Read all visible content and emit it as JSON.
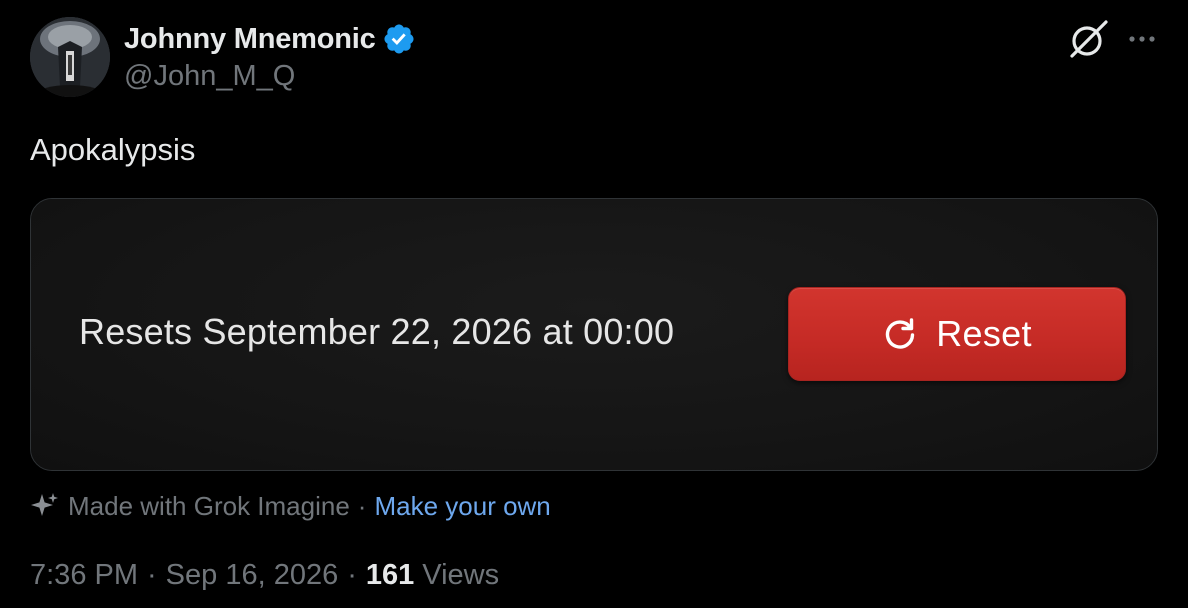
{
  "author": {
    "display_name": "Johnny Mnemonic",
    "handle": "@John_M_Q",
    "verified": true,
    "avatar_icon": "avatar-photo"
  },
  "actions": {
    "grok_icon": "grok-icon",
    "more_icon": "more-dots-icon"
  },
  "tweet": {
    "text": "Apokalypsis"
  },
  "media": {
    "resets_text": "Resets September 22, 2026 at 00:00",
    "reset_button_label": "Reset",
    "reset_icon": "refresh-icon",
    "button_color": "#c62b26"
  },
  "attribution": {
    "made_with": "Made with Grok Imagine",
    "separator": "·",
    "make_your_own": "Make your own",
    "link_color": "#6ea8ee"
  },
  "meta": {
    "time": "7:36 PM",
    "separator": "·",
    "date": "Sep 16, 2026",
    "views_count": "161",
    "views_label": "Views"
  }
}
